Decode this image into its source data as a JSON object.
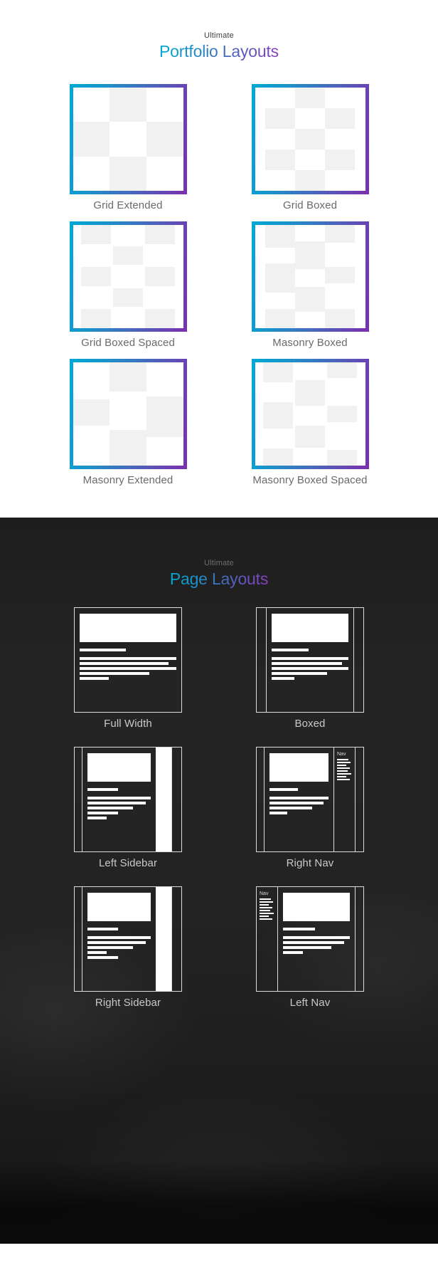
{
  "portfolio_section": {
    "eyebrow": "Ultimate",
    "title": "Portfolio Layouts",
    "gradient_start": "#00a9d4",
    "gradient_end": "#7b2fae",
    "items": [
      {
        "label": "Grid Extended",
        "variant": "extended"
      },
      {
        "label": "Grid Boxed",
        "variant": "boxed"
      },
      {
        "label": "Grid Boxed Spaced",
        "variant": "boxedspaced"
      },
      {
        "label": "Masonry Boxed",
        "variant": "boxed"
      },
      {
        "label": "Masonry Extended",
        "variant": "extended"
      },
      {
        "label": "Masonry Boxed Spaced",
        "variant": "boxedspaced"
      }
    ]
  },
  "page_section": {
    "eyebrow": "Ultimate",
    "title": "Page Layouts",
    "background_color": "#232323",
    "items": [
      {
        "label": "Full Width",
        "nav_label": ""
      },
      {
        "label": "Boxed",
        "nav_label": ""
      },
      {
        "label": "Left Sidebar",
        "nav_label": ""
      },
      {
        "label": "Right Nav",
        "nav_label": "Nav"
      },
      {
        "label": "Right Sidebar",
        "nav_label": ""
      },
      {
        "label": "Left Nav",
        "nav_label": "Nav"
      }
    ]
  }
}
